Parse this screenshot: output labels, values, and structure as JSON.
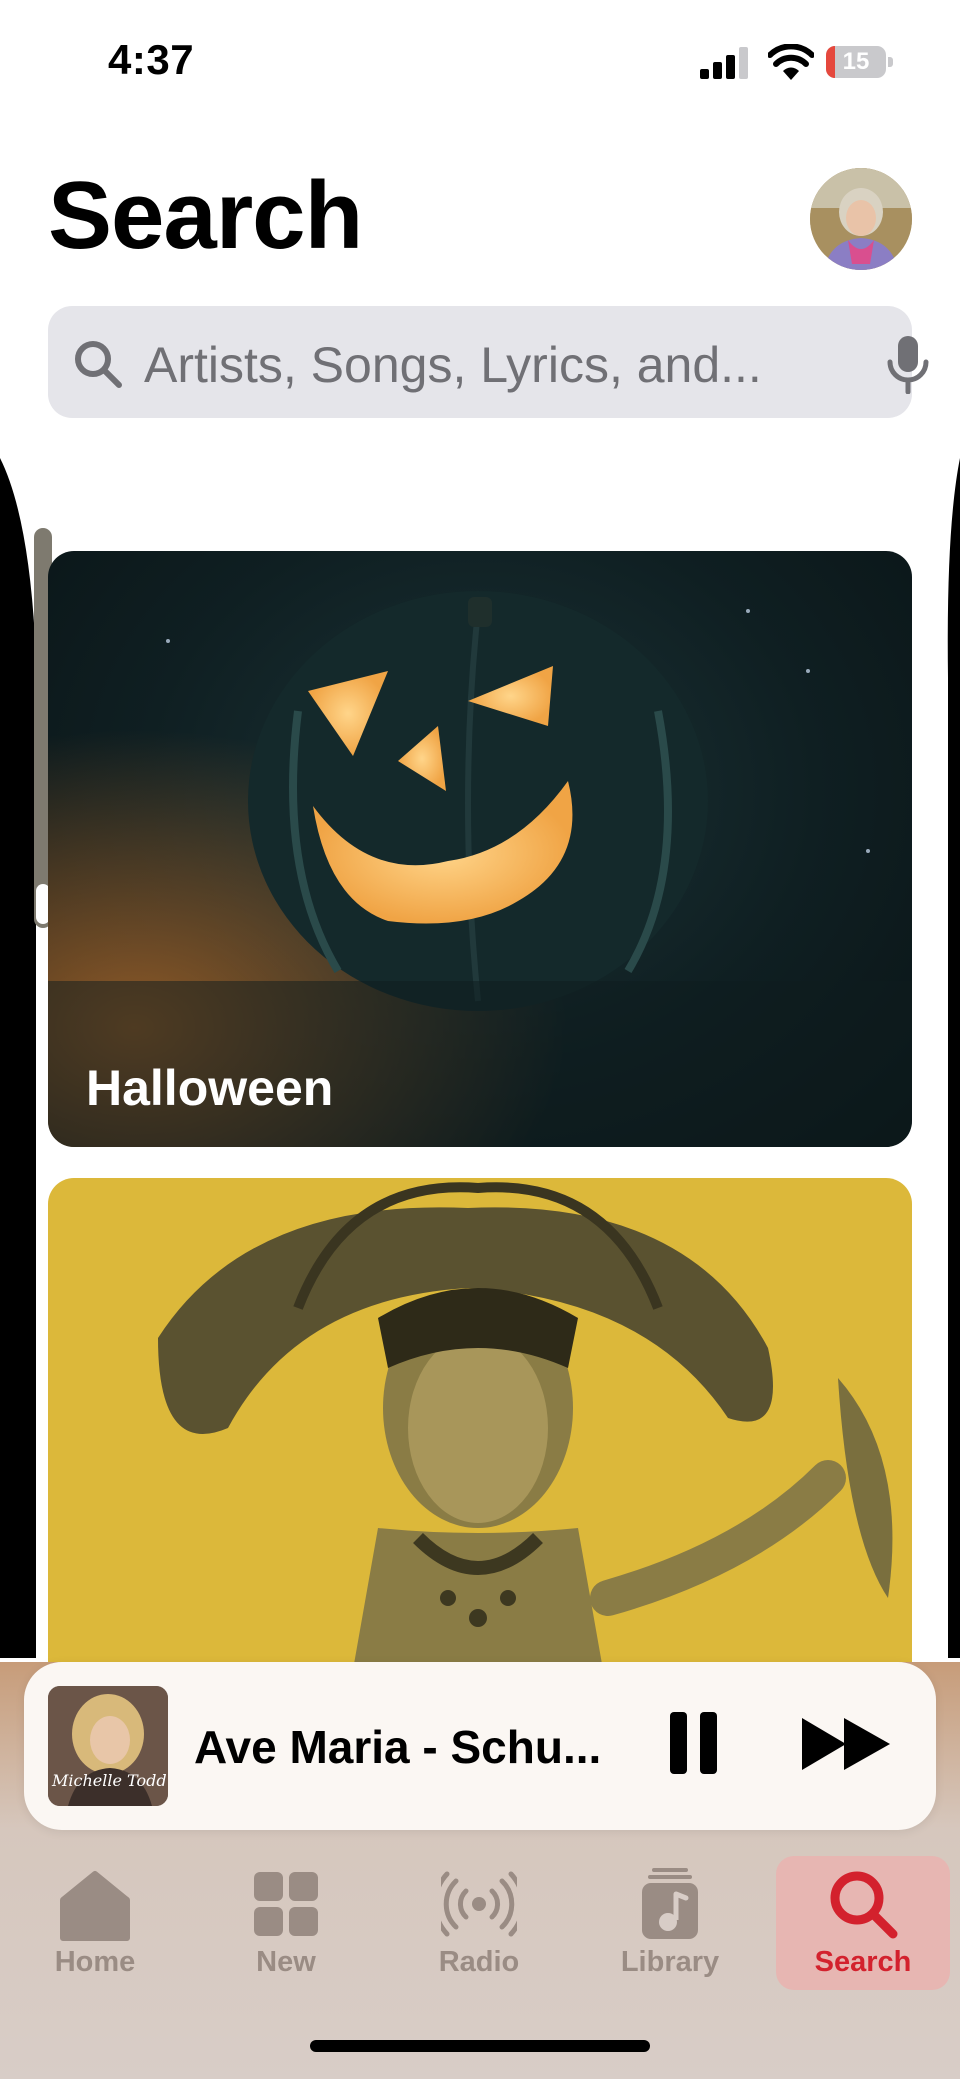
{
  "status_bar": {
    "time": "4:37",
    "battery_level": "15"
  },
  "header": {
    "title": "Search"
  },
  "search": {
    "placeholder": "Artists, Songs, Lyrics, and..."
  },
  "cards": [
    {
      "label": "Halloween"
    },
    {
      "label": ""
    }
  ],
  "now_playing": {
    "title": "Ave Maria - Schu...",
    "artwork_text": "Michelle Todd"
  },
  "tabs": [
    {
      "label": "Home",
      "icon": "house-icon"
    },
    {
      "label": "New",
      "icon": "grid-icon"
    },
    {
      "label": "Radio",
      "icon": "radio-waves-icon"
    },
    {
      "label": "Library",
      "icon": "music-note-stack-icon"
    },
    {
      "label": "Search",
      "icon": "magnifier-icon",
      "active": true
    }
  ],
  "colors": {
    "accent": "#d3212d",
    "inactive_tab": "#9a8c84",
    "search_field": "#e5e5ea"
  }
}
